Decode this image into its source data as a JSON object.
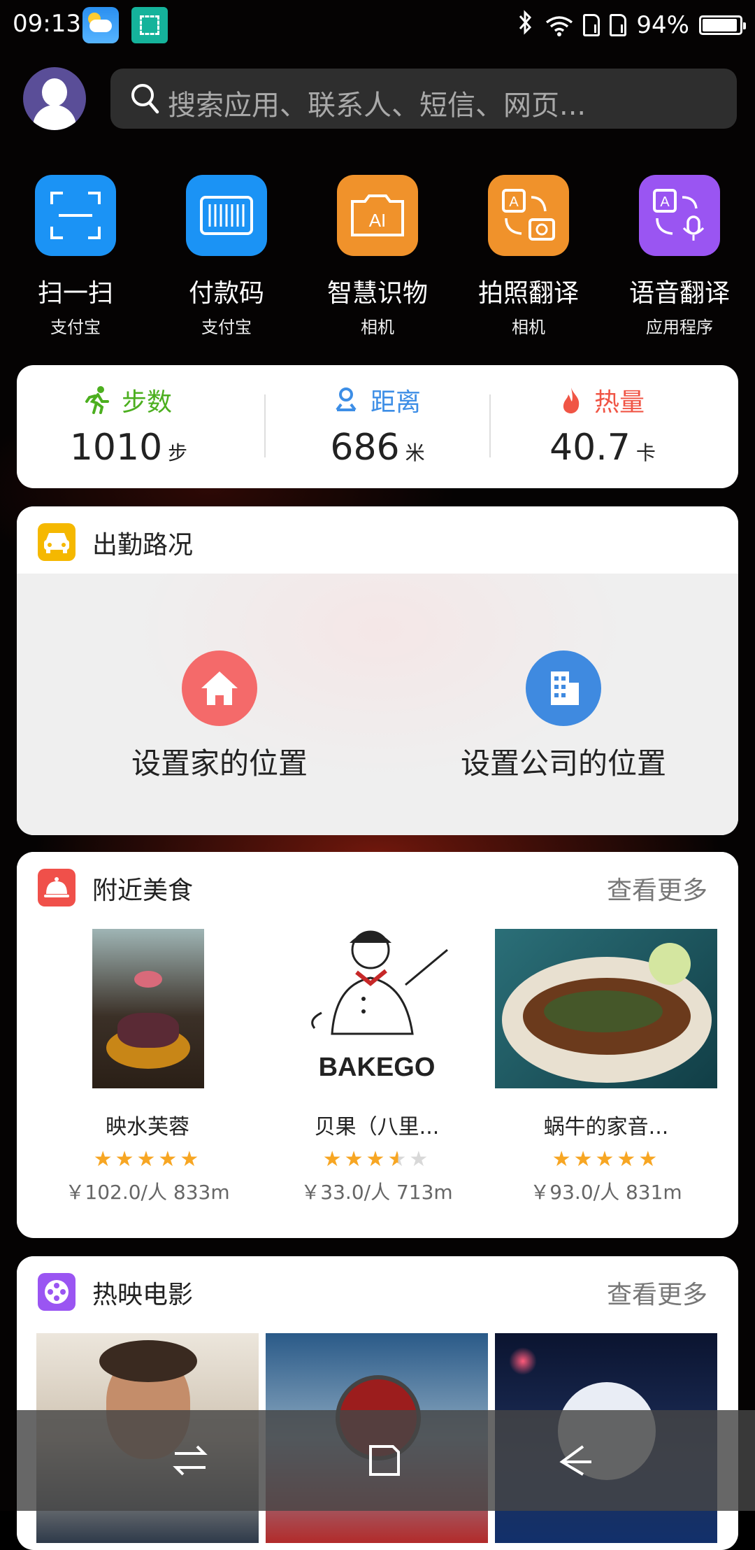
{
  "status_bar": {
    "time": "09:13",
    "battery": "94%",
    "battery_level": 0.94,
    "icons": [
      "weather-app-icon",
      "scanner-app-icon",
      "bluetooth-icon",
      "wifi-icon",
      "sim-icon",
      "sim-icon",
      "battery-icon"
    ]
  },
  "search": {
    "placeholder": "搜索应用、联系人、短信、网页..."
  },
  "shortcuts": [
    {
      "label": "扫一扫",
      "sub": "支付宝",
      "color": "#1b93f5",
      "icon": "scan-icon"
    },
    {
      "label": "付款码",
      "sub": "支付宝",
      "color": "#1b93f5",
      "icon": "barcode-icon"
    },
    {
      "label": "智慧识物",
      "sub": "相机",
      "color": "#f0922b",
      "icon": "ai-camera-icon"
    },
    {
      "label": "拍照翻译",
      "sub": "相机",
      "color": "#f0922b",
      "icon": "photo-translate-icon"
    },
    {
      "label": "语音翻译",
      "sub": "应用程序",
      "color": "#9a55f2",
      "icon": "voice-translate-icon"
    }
  ],
  "fitness": {
    "steps": {
      "label": "步数",
      "value": "1010",
      "unit": "步",
      "color": "#4caf1f"
    },
    "distance": {
      "label": "距离",
      "value": "686",
      "unit": "米",
      "color": "#3d8ee6"
    },
    "calories": {
      "label": "热量",
      "value": "40.7",
      "unit": "卡",
      "color": "#f05545"
    }
  },
  "commute": {
    "title": "出勤路况",
    "home_label": "设置家的位置",
    "office_label": "设置公司的位置",
    "home_color": "#f46a6a",
    "office_color": "#3f8ae0"
  },
  "food": {
    "title": "附近美食",
    "more": "查看更多",
    "items": [
      {
        "name": "映水芙蓉",
        "rating": 5,
        "meta": "￥102.0/人   833m"
      },
      {
        "name": "贝果（八里...",
        "rating": 3.5,
        "meta": "￥33.0/人   713m"
      },
      {
        "name": "蜗牛的家音...",
        "rating": 5,
        "meta": "￥93.0/人   831m"
      }
    ]
  },
  "movies": {
    "title": "热映电影",
    "more": "查看更多"
  },
  "bakery_logo_text": "BAKEGO"
}
